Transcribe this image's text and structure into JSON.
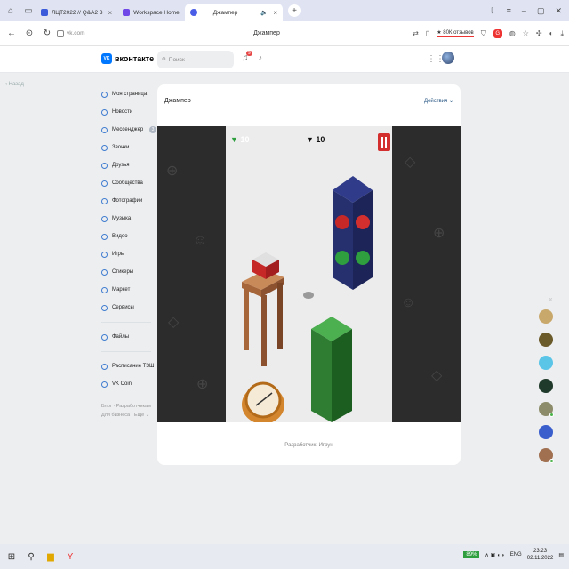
{
  "tabs": [
    {
      "label": "ЛЦТ2022 // Q&A2 3",
      "active": false,
      "color": "#3b5bdb"
    },
    {
      "label": "Workspace Home",
      "active": false,
      "color": "#7048e8"
    },
    {
      "label": "Джампер",
      "active": true,
      "color": "#4a5de6"
    }
  ],
  "address": {
    "url": "vk.com",
    "page_title": "Джампер",
    "reviews": "★ 80К отзывов"
  },
  "vk": {
    "logo": "вконтакте",
    "logo_mark": "VK",
    "search_placeholder": "Поиск",
    "notif_count": "9"
  },
  "back_label": "Назад",
  "menu": {
    "items": [
      "Моя страница",
      "Новости",
      "Мессенджер",
      "Звонки",
      "Друзья",
      "Сообщества",
      "Фотографии",
      "Музыка",
      "Видео",
      "Игры",
      "Стикеры",
      "Маркет",
      "Сервисы"
    ],
    "messenger_badge": "3",
    "files": "Файлы",
    "extra": [
      "Расписание ТЗШ",
      "VK Coin"
    ],
    "footer1": "Блог · Разработчикам",
    "footer2": "Для бизнеса · Ещё ⌄"
  },
  "app": {
    "title": "Джампер",
    "actions": "Действия ⌄",
    "gems_left": "10",
    "gems_center": "10",
    "developer": "Разработчик: Игрун"
  },
  "taskbar": {
    "battery": "89%",
    "lang": "ENG",
    "time": "23:23",
    "date": "02.11.2022"
  },
  "colors": {
    "vk_blue": "#0077ff",
    "link": "#2a5885"
  }
}
